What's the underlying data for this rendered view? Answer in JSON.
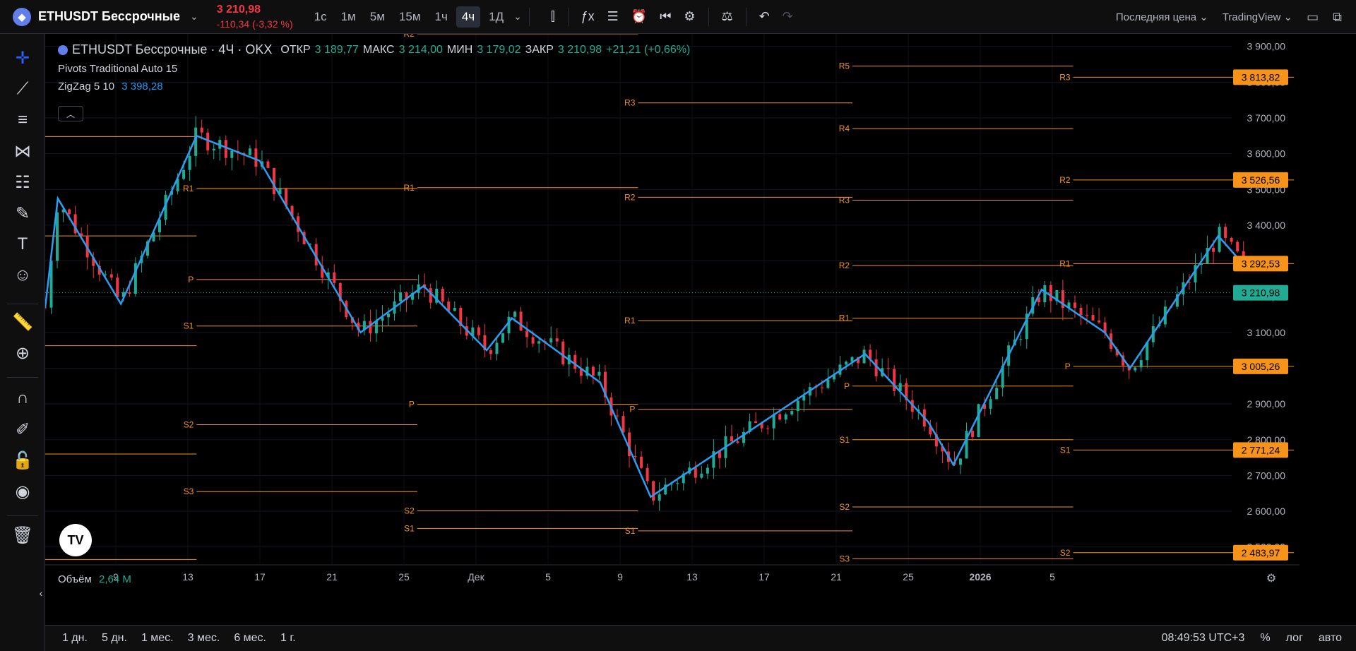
{
  "header": {
    "symbol": "ETHUSDT Бессрочные",
    "last_price": "3 210,98",
    "change": "-110,34 (-3,32 %)",
    "timeframes": [
      "1с",
      "1м",
      "5м",
      "15м",
      "1ч",
      "4ч",
      "1Д"
    ],
    "active_timeframe": "4ч",
    "price_type": "Последняя цена",
    "layout_name": "TradingView"
  },
  "legend": {
    "title": "ETHUSDT Бессрочные · 4Ч · OKX",
    "open_label": "ОТКР",
    "open": "3 189,77",
    "high_label": "МАКС",
    "high": "3 214,00",
    "low_label": "МИН",
    "low": "3 179,02",
    "close_label": "ЗАКР",
    "close": "3 210,98",
    "delta": "+21,21 (+0,66%)",
    "pivots": "Pivots Traditional Auto 15",
    "zigzag_label": "ZigZag 5 10",
    "zigzag_value": "3 398,28",
    "volume_label": "Объём",
    "volume_value": "2,64 M"
  },
  "bottom": {
    "ranges": [
      "1 дн.",
      "5 дн.",
      "1 мес.",
      "3 мес.",
      "6 мес.",
      "1 г."
    ],
    "clock": "08:49:53 UTC+3",
    "percent_label": "%",
    "log_label": "лог",
    "auto_label": "авто"
  },
  "chart_data": {
    "type": "candlestick",
    "y_ticks": [
      "3 900,00",
      "3 800,00",
      "3 700,00",
      "3 600,00",
      "3 500,00",
      "3 400,00",
      "3 300,00",
      "3 200,00",
      "3 100,00",
      "3 000,00",
      "2 900,00",
      "2 800,00",
      "2 700,00",
      "2 600,00",
      "2 500,00"
    ],
    "ylim": [
      2450,
      3935
    ],
    "x_ticks": [
      "9",
      "13",
      "17",
      "21",
      "25",
      "Дек",
      "5",
      "9",
      "13",
      "17",
      "21",
      "25",
      "2026",
      "5"
    ],
    "price_labels": [
      {
        "value": 3813.82,
        "text": "3 813,82",
        "color": "#f7931a"
      },
      {
        "value": 3526.56,
        "text": "3 526,56",
        "color": "#f7931a"
      },
      {
        "value": 3292.53,
        "text": "3 292,53",
        "color": "#f7931a"
      },
      {
        "value": 3210.98,
        "text": "3 210,98",
        "color": "#22ab94"
      },
      {
        "value": 3005.26,
        "text": "3 005,26",
        "color": "#f7931a"
      },
      {
        "value": 2771.24,
        "text": "2 771,24",
        "color": "#f7931a"
      },
      {
        "value": 2483.97,
        "text": "2 483,97",
        "color": "#f7931a"
      }
    ],
    "zigzag": [
      [
        0,
        3170
      ],
      [
        0.1,
        3475
      ],
      [
        0.6,
        3180
      ],
      [
        1.2,
        3650
      ],
      [
        1.7,
        3580
      ],
      [
        2.5,
        3100
      ],
      [
        3.0,
        3230
      ],
      [
        3.5,
        3050
      ],
      [
        3.7,
        3140
      ],
      [
        4.4,
        2960
      ],
      [
        4.8,
        2640
      ],
      [
        6.5,
        3040
      ],
      [
        7.0,
        2850
      ],
      [
        7.2,
        2730
      ],
      [
        7.9,
        3220
      ],
      [
        8.4,
        3100
      ],
      [
        8.6,
        3000
      ],
      [
        9.3,
        3370
      ],
      [
        9.5,
        3290
      ]
    ],
    "pivot_periods": [
      {
        "x0": 0.0,
        "x1": 1.2,
        "levels": [
          {
            "name": "R1",
            "v": 3648
          },
          {
            "name": "P",
            "v": 3370
          },
          {
            "name": "S1",
            "v": 3063
          },
          {
            "name": "S2",
            "v": 2760
          },
          {
            "name": "S3",
            "v": 2465
          }
        ]
      },
      {
        "x0": 1.2,
        "x1": 2.95,
        "levels": [
          {
            "name": "R1",
            "v": 3503
          },
          {
            "name": "P",
            "v": 3248
          },
          {
            "name": "S1",
            "v": 3118
          },
          {
            "name": "S2",
            "v": 2842
          },
          {
            "name": "S3",
            "v": 2655
          }
        ]
      },
      {
        "x0": 2.95,
        "x1": 4.7,
        "levels": [
          {
            "name": "R2",
            "v": 3935
          },
          {
            "name": "R1",
            "v": 3505
          },
          {
            "name": "P",
            "v": 2899
          },
          {
            "name": "S1",
            "v": 2552
          },
          {
            "name": "S2",
            "v": 2601
          }
        ]
      },
      {
        "x0": 4.7,
        "x1": 6.4,
        "levels": [
          {
            "name": "R3",
            "v": 3742
          },
          {
            "name": "R2",
            "v": 3478
          },
          {
            "name": "R1",
            "v": 3133
          },
          {
            "name": "P",
            "v": 2885
          },
          {
            "name": "S1",
            "v": 2545
          }
        ]
      },
      {
        "x0": 6.4,
        "x1": 8.15,
        "levels": [
          {
            "name": "R5",
            "v": 3845
          },
          {
            "name": "R4",
            "v": 3670
          },
          {
            "name": "R3",
            "v": 3470
          },
          {
            "name": "R2",
            "v": 3287
          },
          {
            "name": "R1",
            "v": 3140
          },
          {
            "name": "P",
            "v": 2950
          },
          {
            "name": "S1",
            "v": 2800
          },
          {
            "name": "S2",
            "v": 2612
          },
          {
            "name": "S3",
            "v": 2467
          }
        ]
      },
      {
        "x0": 8.15,
        "x1": 9.9,
        "levels": [
          {
            "name": "R3",
            "v": 3813.82
          },
          {
            "name": "R2",
            "v": 3526.56
          },
          {
            "name": "R1",
            "v": 3292.53
          },
          {
            "name": "P",
            "v": 3005.26
          },
          {
            "name": "S1",
            "v": 2771.24
          },
          {
            "name": "S2",
            "v": 2483.97
          }
        ]
      }
    ],
    "last_price": 3210.98
  }
}
